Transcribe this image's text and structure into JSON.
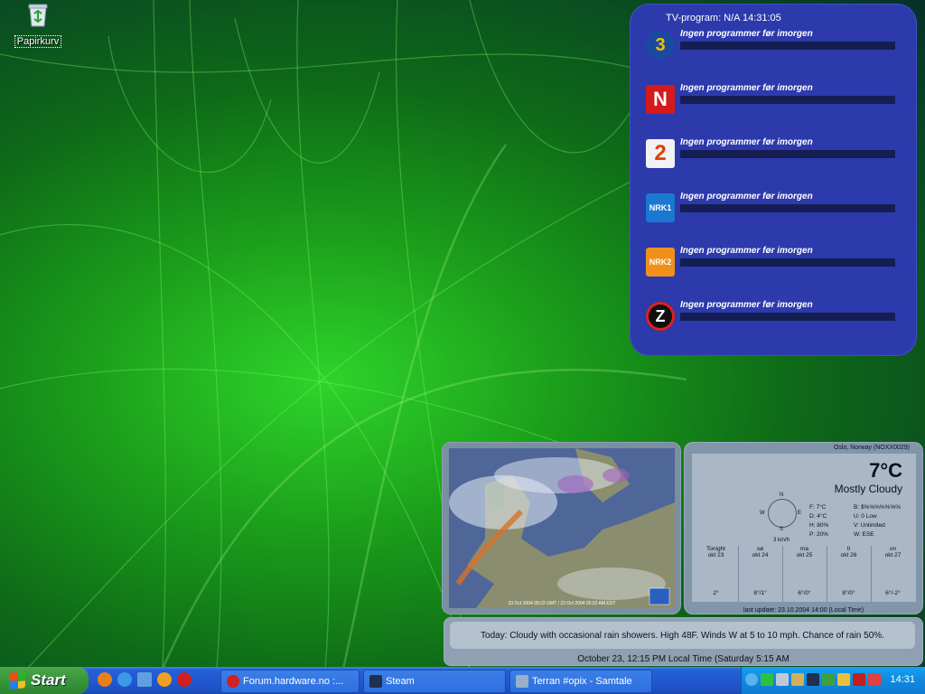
{
  "desktop": {
    "icons": [
      {
        "label": "Papirkurv",
        "icon": "recycle-bin-icon"
      }
    ]
  },
  "tv_widget": {
    "header": "TV-program: N/A 14:31:05",
    "channels": [
      {
        "logo_text": "3",
        "logo_bg": "#1a4aa0",
        "logo_color": "#f0c000",
        "program": "Ingen programmer før imorgen"
      },
      {
        "logo_text": "N",
        "logo_bg": "#d41a1a",
        "logo_color": "#ffffff",
        "program": "Ingen programmer før imorgen"
      },
      {
        "logo_text": "2",
        "logo_bg": "#f2f2f2",
        "logo_color": "#d8400a",
        "program": "Ingen programmer før imorgen"
      },
      {
        "logo_text": "NRK1",
        "logo_bg": "#1a78d0",
        "logo_color": "#ffffff",
        "program": "Ingen programmer før imorgen"
      },
      {
        "logo_text": "NRK2",
        "logo_bg": "#f0901a",
        "logo_color": "#ffffff",
        "program": "Ingen programmer før imorgen"
      },
      {
        "logo_text": "Z",
        "logo_bg": "#101010",
        "logo_color": "#ffffff",
        "program": "Ingen programmer før imorgen"
      }
    ]
  },
  "radar": {
    "timestamp": "23 Oct 2004 09:22 GMT / 23 Oct 2004 05:22 AM EDT",
    "badge": "THE WEATHER CHANNEL"
  },
  "weather": {
    "location": "Oslo, Norway (NOXX0029)",
    "temperature": "7°C",
    "condition": "Mostly Cloudy",
    "compass": {
      "n": "N",
      "e": "E",
      "s": "S",
      "w": "W"
    },
    "wind_speed": "3 km/h",
    "stats_left": [
      "F: 7°C",
      "D: 4°C",
      "H: 80%",
      "P: 20%"
    ],
    "stats_right": [
      "B: $%%%%%%%",
      "U: 0 Low",
      "V: Unlimited",
      "W: ESE"
    ],
    "forecast": [
      {
        "day": "Tonight",
        "date": "okt 23",
        "temp": "2°"
      },
      {
        "day": "sø",
        "date": "okt 24",
        "temp": "8°/1°"
      },
      {
        "day": "ma",
        "date": "okt 25",
        "temp": "6°/0°"
      },
      {
        "day": "ti",
        "date": "okt 26",
        "temp": "8°/0°"
      },
      {
        "day": "on",
        "date": "okt 27",
        "temp": "6°/-2°"
      }
    ],
    "last_update": "last update: 23.10.2004 14:00 (Local Time)"
  },
  "forecast_text": {
    "today": "Today: Cloudy with occasional rain showers. High 48F. Winds W at 5 to 10 mph. Chance of rain 50%.",
    "local_time": "October 23, 12:15 PM Local Time (Saturday 5:15 AM"
  },
  "taskbar": {
    "start_label": "Start",
    "quick_launch": [
      {
        "name": "firefox-icon",
        "color": "#e8801a"
      },
      {
        "name": "internet-explorer-icon",
        "color": "#3a9ae8"
      },
      {
        "name": "notepad-icon",
        "color": "#60a0e0"
      },
      {
        "name": "media-player-icon",
        "color": "#f0a020"
      },
      {
        "name": "opera-icon",
        "color": "#d02020"
      }
    ],
    "tasks": [
      {
        "label": "Forum.hardware.no :...",
        "icon": "opera-icon",
        "color": "#d02020"
      },
      {
        "label": "Steam",
        "icon": "steam-icon",
        "color": "#203050"
      },
      {
        "label": "Terran #opix - Samtale",
        "icon": "chat-icon",
        "color": "#9ab0c8"
      }
    ],
    "tray_icons": [
      {
        "name": "chevron-left-icon",
        "color": "#5ab0f0"
      },
      {
        "name": "network-icon",
        "color": "#30c040"
      },
      {
        "name": "sound-icon",
        "color": "#c0c8d8"
      },
      {
        "name": "users-icon",
        "color": "#d0b060"
      },
      {
        "name": "steam-icon",
        "color": "#203050"
      },
      {
        "name": "monitor-icon",
        "color": "#40a040"
      },
      {
        "name": "folder-icon",
        "color": "#e8c040"
      },
      {
        "name": "ati-icon",
        "color": "#c02020"
      },
      {
        "name": "chart-icon",
        "color": "#e04040"
      }
    ],
    "clock": "14:31"
  }
}
